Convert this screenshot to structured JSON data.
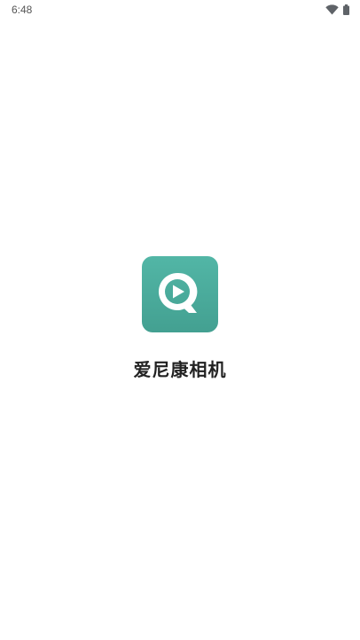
{
  "status_bar": {
    "time": "6:48",
    "icons": [
      "wifi-icon",
      "battery-icon"
    ]
  },
  "splash": {
    "app_name": "爱尼康相机",
    "logo_icon": "play-chat-icon"
  },
  "colors": {
    "icon_bg_top": "#52b6a6",
    "icon_bg_bottom": "#43a091",
    "icon_fg": "#ffffff",
    "title_text": "#222222"
  }
}
